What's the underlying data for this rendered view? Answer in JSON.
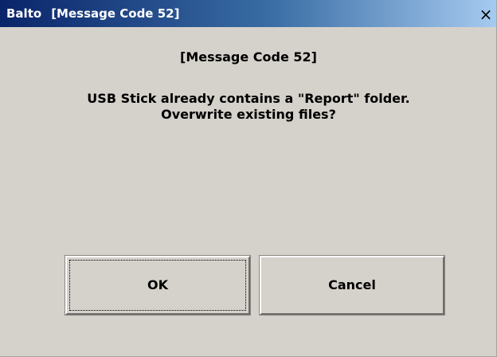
{
  "window": {
    "app_name": "Balto",
    "title": "[Message Code 52]",
    "close_label": "×"
  },
  "message": {
    "heading": "[Message Code 52]",
    "line1": "USB Stick already contains a \"Report\" folder.",
    "line2": "Overwrite existing files?"
  },
  "buttons": {
    "ok_label": "OK",
    "cancel_label": "Cancel"
  },
  "colors": {
    "dialog_background": "#d5d1cb",
    "titlebar_start": "#0a246a",
    "titlebar_end": "#a6caf0"
  }
}
